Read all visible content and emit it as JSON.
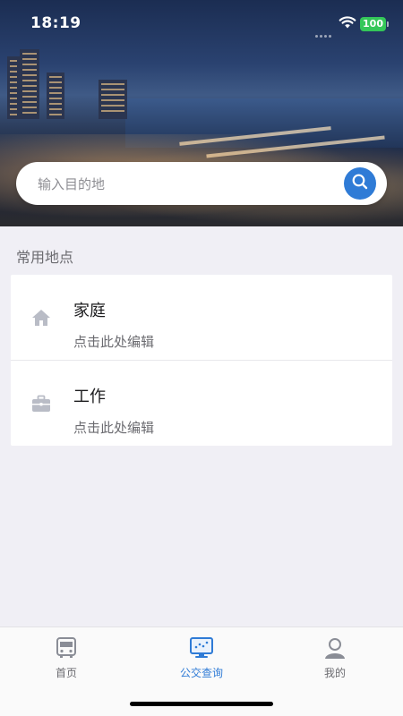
{
  "status_bar": {
    "time": "18:19",
    "battery": "100",
    "battery_color": "#34c759"
  },
  "search": {
    "placeholder": "输入目的地",
    "icon": "search-icon",
    "button_color": "#2f7bd6"
  },
  "favorites": {
    "title": "常用地点",
    "items": [
      {
        "icon": "home-icon",
        "name": "家庭",
        "hint": "点击此处编辑"
      },
      {
        "icon": "briefcase-icon",
        "name": "工作",
        "hint": "点击此处编辑"
      }
    ]
  },
  "tab_bar": {
    "active_color": "#2f7bd6",
    "tabs": [
      {
        "icon": "bus-icon",
        "label": "首页",
        "active": false
      },
      {
        "icon": "bus-query-screen-icon",
        "label": "公交查询",
        "active": true
      },
      {
        "icon": "user-icon",
        "label": "我的",
        "active": false
      }
    ]
  }
}
